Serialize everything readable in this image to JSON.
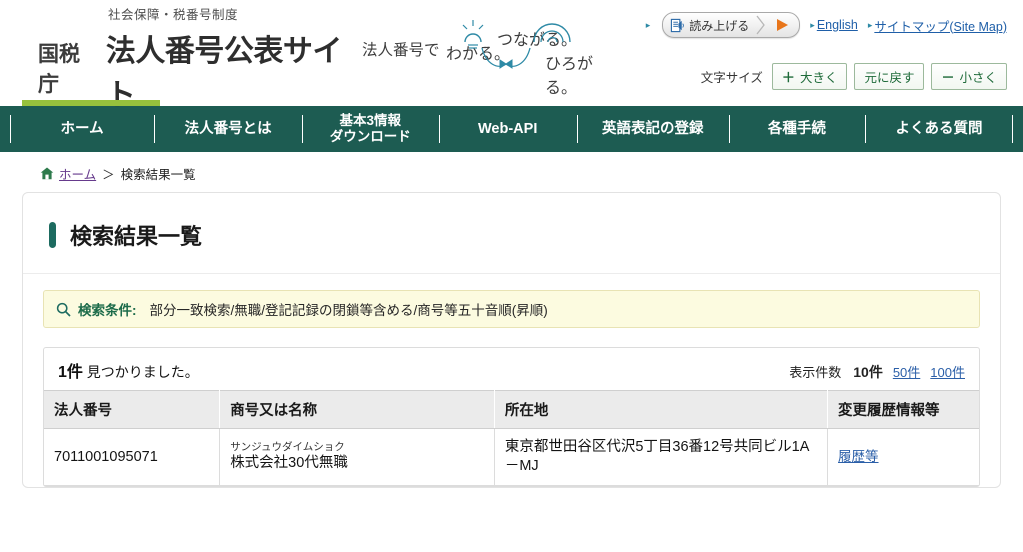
{
  "header": {
    "brand_sub": "社会保障・税番号制度",
    "brand_agency": "国税庁",
    "brand_title": "法人番号公表サイト",
    "tagline_1": "法人番号で",
    "tagline_2": "わかる。",
    "tagline_3": "つながる。",
    "tagline_4": "ひろがる。",
    "speak_label": "読み上げる",
    "speak_icon": "document-speaker-icon",
    "play_icon": "play-triangle-icon",
    "english_link": "English",
    "sitemap_link": "サイトマップ(Site Map)",
    "fontsize_label": "文字サイズ",
    "fontsize_larger_sym": "＋",
    "fontsize_larger": "大きく",
    "fontsize_reset": "元に戻す",
    "fontsize_smaller_sym": "－",
    "fontsize_smaller": "小さく",
    "accent_green": "#97c13d",
    "nav_bg": "#1d5c52"
  },
  "nav": {
    "items": [
      {
        "label": "ホーム",
        "active": true
      },
      {
        "label": "法人番号とは",
        "active": false
      },
      {
        "label": "基本3情報\nダウンロード",
        "active": false
      },
      {
        "label": "Web-API",
        "active": false
      },
      {
        "label": "英語表記の登録",
        "active": false
      },
      {
        "label": "各種手続",
        "active": false
      },
      {
        "label": "よくある質問",
        "active": false
      }
    ]
  },
  "breadcrumb": {
    "home_icon": "home-icon",
    "home_label": "ホーム",
    "separator": "＞",
    "current": "検索結果一覧"
  },
  "page": {
    "title": "検索結果一覧",
    "title_accent": "#1d6b60"
  },
  "conditions": {
    "icon": "search-icon",
    "label": "検索条件:",
    "value": "部分一致検索/無職/登記記録の閉鎖等含める/商号等五十音順(昇順)",
    "bg": "#fcfbe0"
  },
  "results": {
    "hit_count_num": "1件",
    "hit_count_text": "見つかりました。",
    "per_page_label": "表示件数",
    "per_page_current": "10件",
    "per_page_options": [
      "50件",
      "100件"
    ],
    "columns": [
      "法人番号",
      "商号又は名称",
      "所在地",
      "変更履歴情報等"
    ],
    "rows": [
      {
        "corporate_number": "7011001095071",
        "name_furigana": "サンジュウダイムショク",
        "name": "株式会社30代無職",
        "address": "東京都世田谷区代沢5丁目36番12号共同ビル1A－MJ",
        "history_link": "履歴等"
      }
    ]
  }
}
